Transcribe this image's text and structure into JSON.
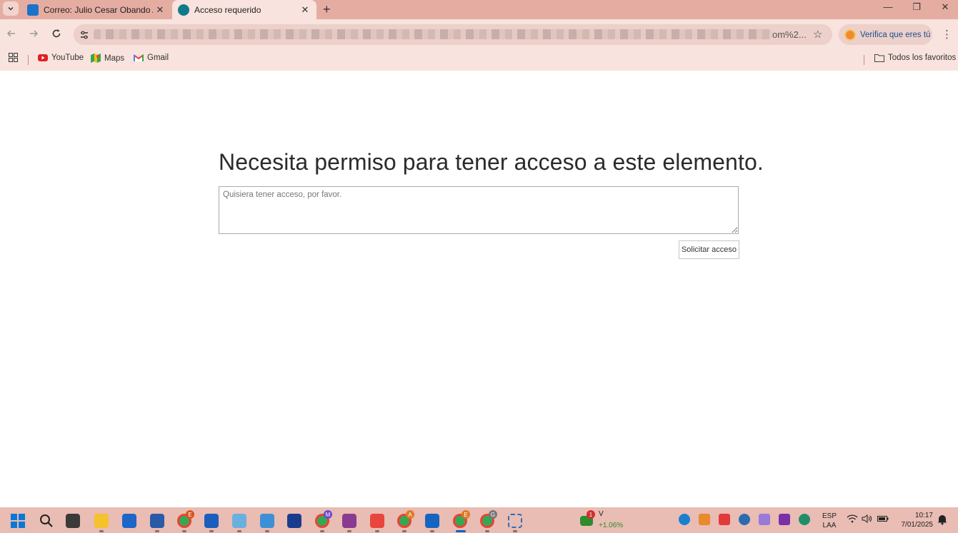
{
  "browser": {
    "tabs": [
      {
        "title": "Correo: Julio Cesar Obando Ala",
        "active": false
      },
      {
        "title": "Acceso requerido",
        "active": true
      }
    ],
    "url_tail": "om%2...",
    "profile_button": "Verifica que eres tú",
    "bookmarks": [
      {
        "label": "YouTube",
        "icon": "youtube-icon"
      },
      {
        "label": "Maps",
        "icon": "maps-icon"
      },
      {
        "label": "Gmail",
        "icon": "gmail-icon"
      }
    ],
    "all_bookmarks": "Todos los favoritos"
  },
  "page": {
    "heading": "Necesita permiso para tener acceso a este elemento.",
    "message_placeholder": "Quisiera tener acceso, por favor.",
    "request_button": "Solicitar acceso"
  },
  "taskbar": {
    "stock": {
      "badge": "1",
      "ticker": "V",
      "change": "+1.06%",
      "change_color": "#2e8b2e"
    },
    "badges": {
      "chrome_e": "E",
      "chrome_m": "M",
      "chrome_a": "A",
      "chrome_e2": "E",
      "chrome_g": "G"
    },
    "language": {
      "code": "ESP",
      "layout": "LAA"
    },
    "time": "10:17",
    "date": "7/01/2025"
  },
  "colors": {
    "tabstrip": "#e5ada2",
    "toolbar": "#f8e3de",
    "taskbar": "#e9bcb4",
    "verify_text": "#1a4f8f"
  }
}
